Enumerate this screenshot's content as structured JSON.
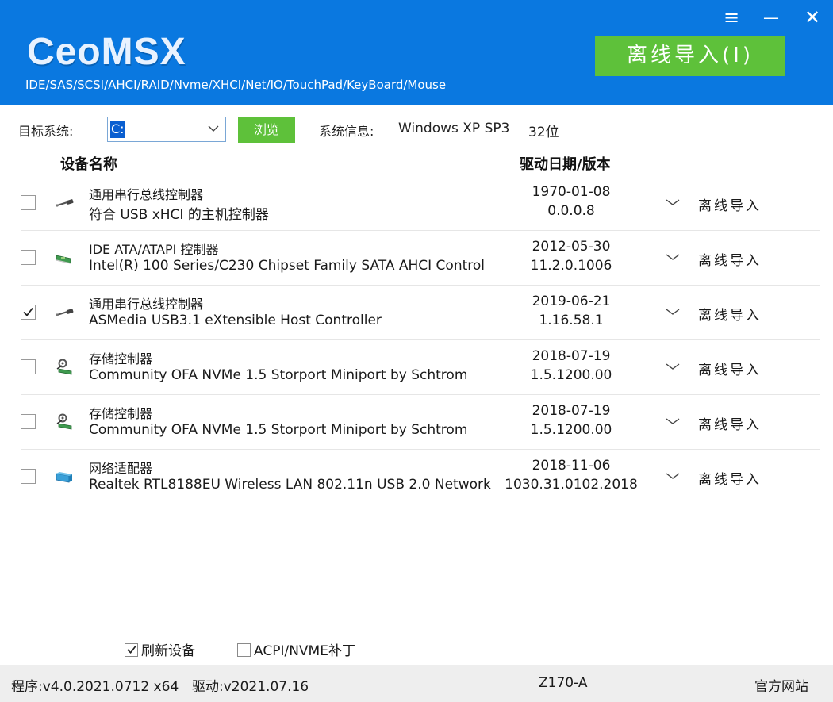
{
  "header": {
    "logo_text": "CeoMSX",
    "subtitle": "IDE/SAS/SCSI/AHCI/RAID/Nvme/XHCI/Net/IO/TouchPad/KeyBoard/Mouse",
    "menu_icon": "≡",
    "minimize_icon": "—",
    "close_icon": "✕",
    "offline_import_label": "离线导入(I)",
    "bg_color": "#0a78e0",
    "accent_green": "#5ec13a"
  },
  "toolbar": {
    "target_label": "目标系统:",
    "target_value": "C:",
    "browse_label": "浏览",
    "sysinfo_label": "系统信息:",
    "sysinfo_os": "Windows XP SP3",
    "sysinfo_bits": "32位"
  },
  "columns": {
    "device_name": "设备名称",
    "driver_date_version": "驱动日期/版本"
  },
  "devices": [
    {
      "checked": false,
      "icon": "usb-icon",
      "category": "通用串行总线控制器",
      "name": "符合 USB xHCI 的主机控制器",
      "date": "1970-01-08",
      "version": "0.0.0.8",
      "action": "离线导入"
    },
    {
      "checked": false,
      "icon": "ide-controller-icon",
      "category": "IDE ATA/ATAPI 控制器",
      "name": "Intel(R) 100 Series/C230 Chipset Family SATA AHCI Control",
      "date": "2012-05-30",
      "version": "11.2.0.1006",
      "action": "离线导入"
    },
    {
      "checked": true,
      "icon": "usb-icon",
      "category": "通用串行总线控制器",
      "name": "ASMedia USB3.1 eXtensible Host Controller",
      "date": "2019-06-21",
      "version": "1.16.58.1",
      "action": "离线导入"
    },
    {
      "checked": false,
      "icon": "storage-controller-icon",
      "category": "存储控制器",
      "name": "Community OFA NVMe 1.5 Storport Miniport by Schtrom",
      "date": "2018-07-19",
      "version": "1.5.1200.00",
      "action": "离线导入"
    },
    {
      "checked": false,
      "icon": "storage-controller-icon",
      "category": "存储控制器",
      "name": "Community OFA NVMe 1.5 Storport Miniport by Schtrom",
      "date": "2018-07-19",
      "version": "1.5.1200.00",
      "action": "离线导入"
    },
    {
      "checked": false,
      "icon": "network-adapter-icon",
      "category": "网络适配器",
      "name": "Realtek RTL8188EU Wireless LAN 802.11n USB 2.0 Network",
      "date": "2018-11-06",
      "version": "1030.31.0102.2018",
      "action": "离线导入"
    }
  ],
  "options": {
    "refresh_devices_label": "刷新设备",
    "refresh_devices_checked": true,
    "acpi_patch_label": "ACPI/NVME补丁",
    "acpi_patch_checked": false
  },
  "status": {
    "program_version": "程序:v4.0.2021.0712 x64",
    "driver_version": "驱动:v2021.07.16",
    "board": "Z170-A",
    "website": "官方网站"
  }
}
